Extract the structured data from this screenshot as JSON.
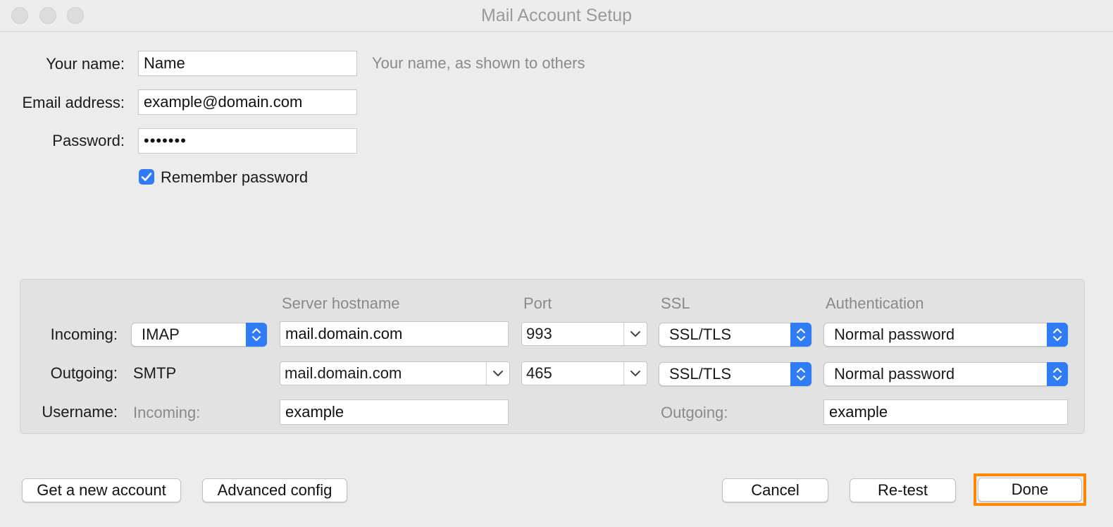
{
  "window": {
    "title": "Mail Account Setup"
  },
  "colors": {
    "accent": "#2f7cf6",
    "focus": "#ff8a00"
  },
  "form": {
    "name_label": "Your name:",
    "name_value": "Name",
    "name_hint": "Your name, as shown to others",
    "email_label": "Email address:",
    "email_value": "example@domain.com",
    "password_label": "Password:",
    "password_value": "•••••••",
    "remember_label": "Remember password",
    "remember_checked": true
  },
  "server": {
    "headers": {
      "hostname": "Server hostname",
      "port": "Port",
      "ssl": "SSL",
      "auth": "Authentication"
    },
    "incoming": {
      "label": "Incoming:",
      "protocol": "IMAP",
      "hostname": "mail.domain.com",
      "port": "993",
      "ssl": "SSL/TLS",
      "auth": "Normal password"
    },
    "outgoing": {
      "label": "Outgoing:",
      "protocol": "SMTP",
      "hostname": "mail.domain.com",
      "port": "465",
      "ssl": "SSL/TLS",
      "auth": "Normal password"
    },
    "username": {
      "label": "Username:",
      "incoming_label": "Incoming:",
      "incoming_value": "example",
      "outgoing_label": "Outgoing:",
      "outgoing_value": "example"
    }
  },
  "buttons": {
    "get_account": "Get a new account",
    "advanced": "Advanced config",
    "cancel": "Cancel",
    "retest": "Re-test",
    "done": "Done"
  }
}
